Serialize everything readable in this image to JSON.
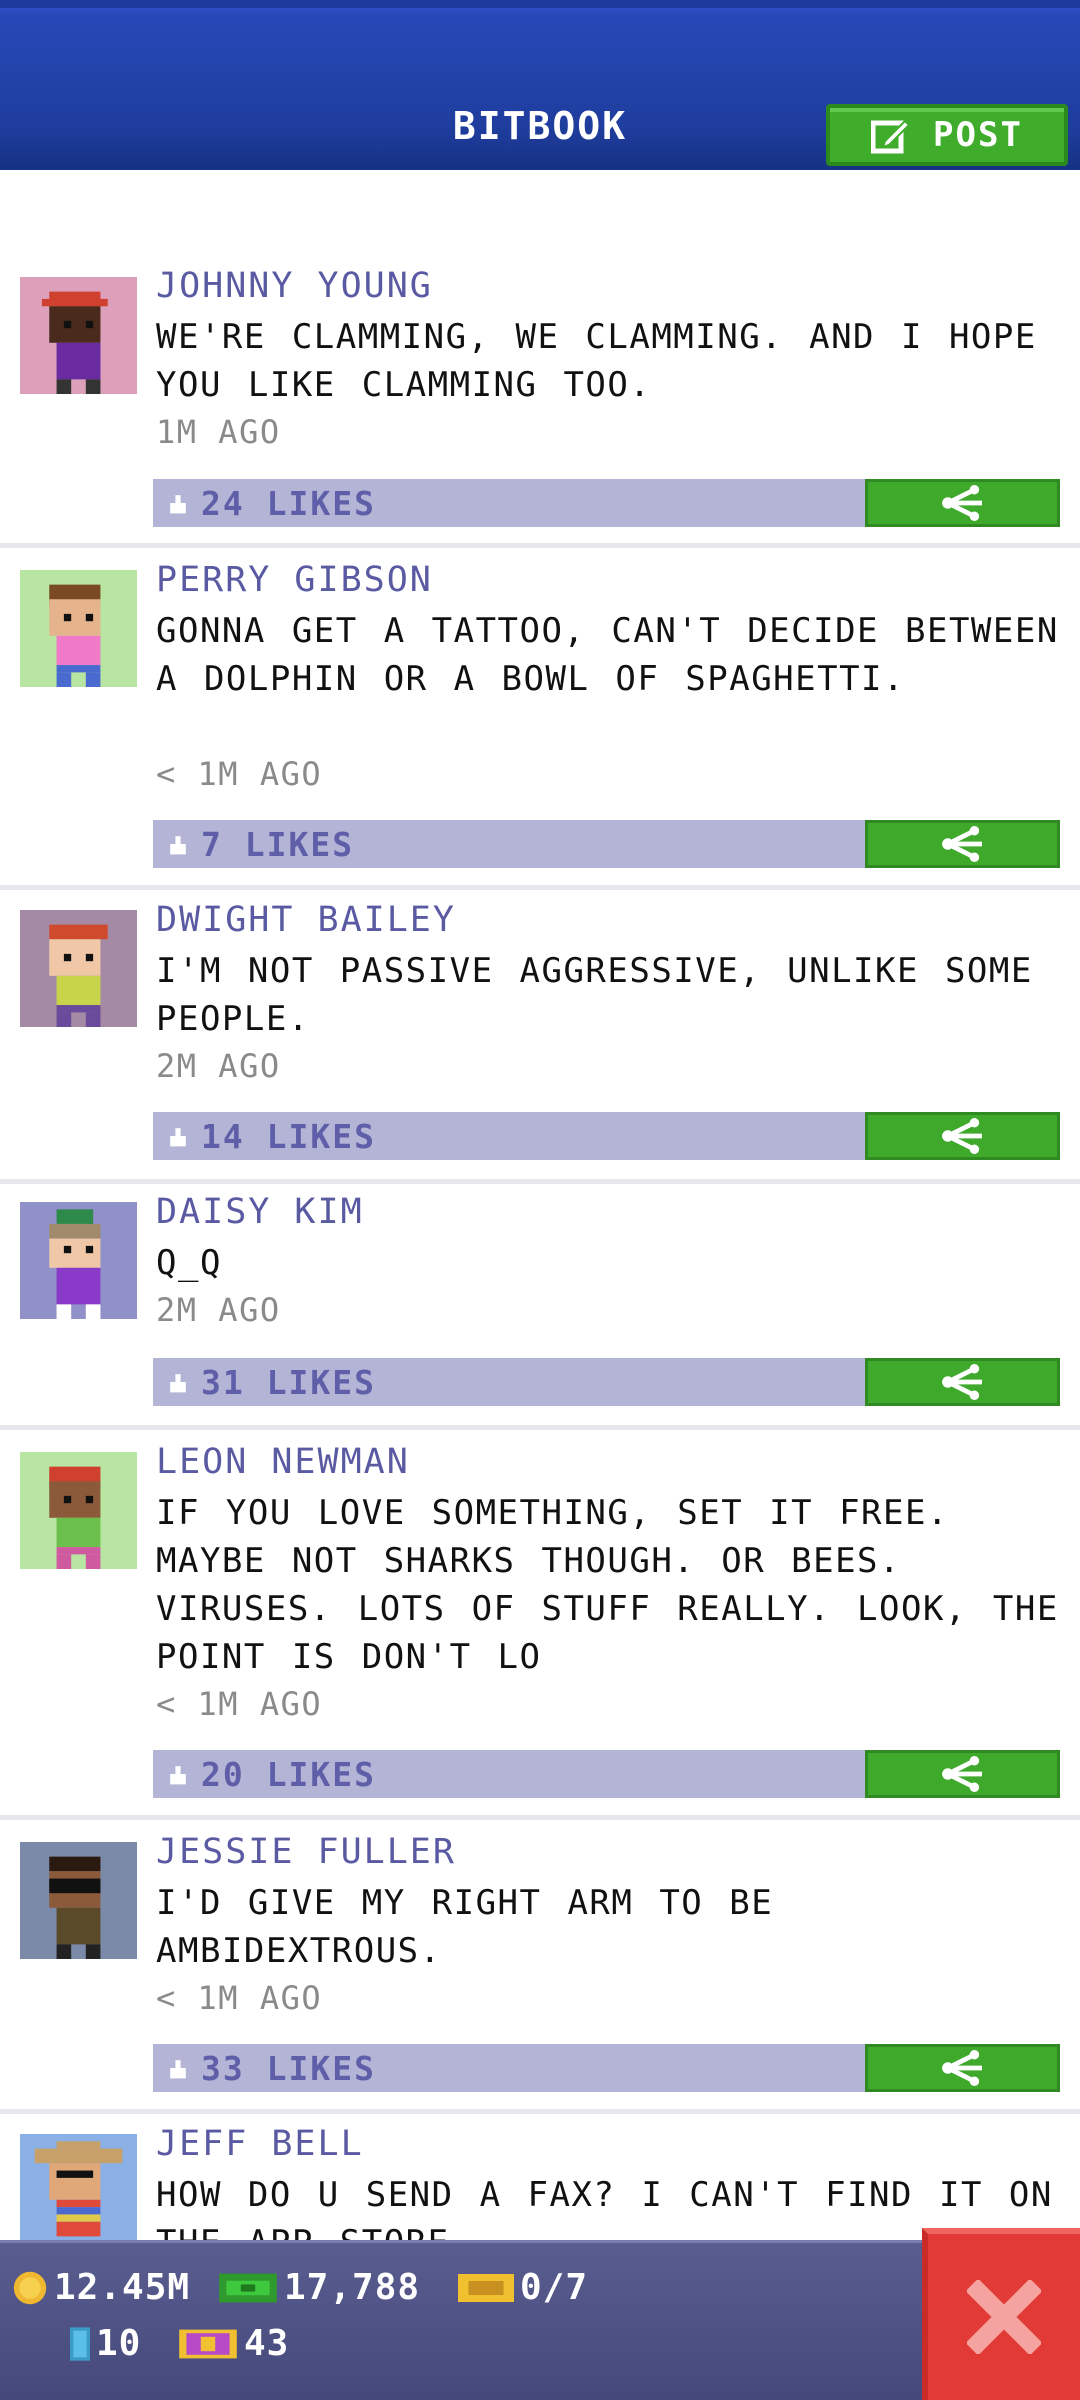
{
  "header": {
    "title": "BITBOOK",
    "post_label": "POST"
  },
  "posts": [
    {
      "name": "JOHNNY YOUNG",
      "message": "WE'RE CLAMMING, WE CLAMMING. AND I HOPE YOU LIKE CLAMMING TOO.",
      "time": "1M AGO",
      "likes": "24 LIKES",
      "avatar_bg": "#dca0bb"
    },
    {
      "name": "PERRY GIBSON",
      "message": "GONNA GET A TATTOO, CAN'T DECIDE BETWEEN A DOLPHIN OR A BOWL OF SPAGHETTI.",
      "time": "< 1M AGO",
      "likes": "7 LIKES",
      "avatar_bg": "#b8e6a2"
    },
    {
      "name": "DWIGHT BAILEY",
      "message": "I'M NOT PASSIVE AGGRESSIVE, UNLIKE SOME PEOPLE.",
      "time": "2M AGO",
      "likes": "14 LIKES",
      "avatar_bg": "#a48aa5"
    },
    {
      "name": "DAISY KIM",
      "message": "Q_Q",
      "time": "2M AGO",
      "likes": "31 LIKES",
      "avatar_bg": "#9091c8"
    },
    {
      "name": "LEON NEWMAN",
      "message": "IF YOU LOVE SOMETHING, SET IT FREE. MAYBE NOT SHARKS THOUGH. OR BEES. VIRUSES. LOTS OF STUFF REALLY. LOOK, THE POINT IS DON'T LO",
      "time": "< 1M AGO",
      "likes": "20 LIKES",
      "avatar_bg": "#b8e6a2"
    },
    {
      "name": "JESSIE FULLER",
      "message": "I'D GIVE MY RIGHT ARM TO BE AMBIDEXTROUS.",
      "time": "< 1M AGO",
      "likes": "33 LIKES",
      "avatar_bg": "#7b8aa8"
    },
    {
      "name": "JEFF BELL",
      "message": "HOW DO U SEND A FAX? I CAN'T FIND IT ON THE APP STORE",
      "time": "",
      "likes": "",
      "avatar_bg": "#8ab0e6"
    }
  ],
  "status": {
    "coins": "12.45M",
    "bux": "17,788",
    "vip": "0/7",
    "elevator_tokens": "10",
    "tower_tickets": "43"
  }
}
